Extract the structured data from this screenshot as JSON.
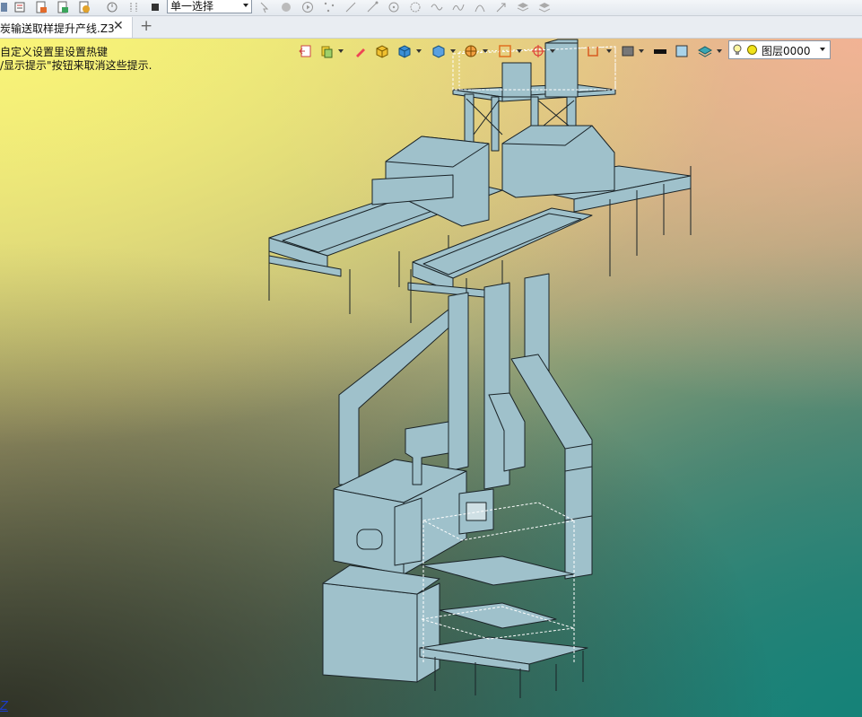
{
  "toolbar": {
    "selection_mode": "单一选择",
    "icons": [
      "tb-grid-icon",
      "tb-list-icon",
      "tb-doc-icon",
      "tb-doc-icon",
      "tb-doc-icon",
      "history-icon",
      "tb-arrow-icon",
      "stop-icon"
    ],
    "filter_icons": [
      "pick-arrow-icon",
      "pick-face-icon",
      "pick-play-icon",
      "pick-points-icon",
      "pick-line-icon",
      "pick-line2-icon",
      "pick-circle-icon",
      "pick-gear-icon",
      "pick-wave-icon",
      "pick-curve-icon",
      "pick-arc-icon",
      "pick-arrow2-icon",
      "pick-layers-icon",
      "pick-layers2-icon"
    ]
  },
  "tab": {
    "title": "炭输送取样提升产线.Z3",
    "close_glyph": "✕",
    "new_tab_glyph": "+"
  },
  "viewport": {
    "hint_line1": "自定义设置里设置热键",
    "hint_line2": "/显示提示\"按钮来取消这些提示.",
    "axis_label": "Z",
    "layer_name": "图层0000",
    "toolbar_icons": [
      "export-icon",
      "layers-tool-icon",
      "pencil-icon",
      "box-shade-icon",
      "cube-blue-icon",
      "view-orient-icon",
      "wireframe-icon",
      "frame-icon",
      "target-icon",
      "dimension-icon",
      "display-mode-icon",
      "line-weight-icon",
      "color-swatch-icon",
      "layer-stack-icon",
      "bulb-icon"
    ],
    "colors": {
      "model_fill": "#9fc1cb",
      "model_stroke": "#1a2327",
      "selection_dash": "#ffffff",
      "layer_dot": "#f0e21a"
    }
  }
}
